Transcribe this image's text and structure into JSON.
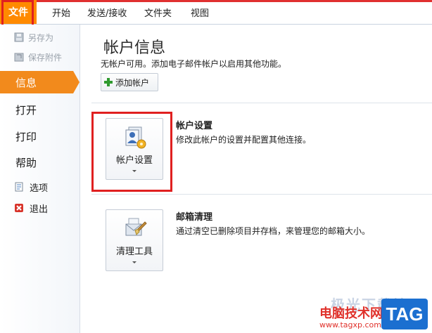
{
  "ribbon": {
    "tabs": [
      {
        "label": "文件"
      },
      {
        "label": "开始"
      },
      {
        "label": "发送/接收"
      },
      {
        "label": "文件夹"
      },
      {
        "label": "视图"
      }
    ]
  },
  "sidebar": {
    "save_as": "另存为",
    "save_attachments": "保存附件",
    "info": "信息",
    "open": "打开",
    "print": "打印",
    "help": "帮助",
    "options": "选项",
    "exit": "退出"
  },
  "main": {
    "title": "帐户信息",
    "subtitle": "无帐户可用。添加电子邮件帐户以启用其他功能。",
    "add_account_label": "添加帐户",
    "account_settings": {
      "button_label": "帐户设置",
      "heading": "帐户设置",
      "description": "修改此帐户的设置并配置其他连接。"
    },
    "mailbox_cleanup": {
      "button_label": "清理工具",
      "heading": "邮箱清理",
      "description": "通过清空已删除项目并存档，来管理您的邮箱大小。"
    }
  },
  "watermark": {
    "line1": "极光下载站",
    "line2": "电脑技术网",
    "url": "www.tagxp.com",
    "badge": "TAG"
  },
  "colors": {
    "file_tab": "#ff8a00",
    "active_nav": "#f28a1c",
    "highlight": "#e02020"
  },
  "icons": {
    "save_as": "save-as-icon",
    "save_attachments": "save-attachments-icon",
    "options": "options-icon",
    "exit": "exit-icon",
    "add": "plus-icon",
    "account_settings": "account-settings-icon",
    "cleanup": "cleanup-tools-icon"
  }
}
